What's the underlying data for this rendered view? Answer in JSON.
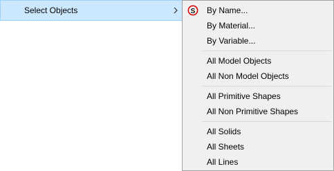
{
  "parent_menu": {
    "label": "Select Objects"
  },
  "submenu": {
    "groups": [
      {
        "items": [
          {
            "label": "By Name...",
            "icon": "select-by-name-icon"
          },
          {
            "label": "By Material..."
          },
          {
            "label": "By Variable..."
          }
        ]
      },
      {
        "items": [
          {
            "label": "All Model Objects"
          },
          {
            "label": "All Non Model Objects"
          }
        ]
      },
      {
        "items": [
          {
            "label": "All Primitive Shapes"
          },
          {
            "label": "All Non Primitive Shapes"
          }
        ]
      },
      {
        "items": [
          {
            "label": "All Solids"
          },
          {
            "label": "All Sheets"
          },
          {
            "label": "All Lines"
          }
        ]
      }
    ]
  },
  "colors": {
    "highlight_fill": "#cce8ff",
    "highlight_border": "#99d1ff",
    "menu_background": "#f0f0f0",
    "icon_red": "#d40000"
  }
}
